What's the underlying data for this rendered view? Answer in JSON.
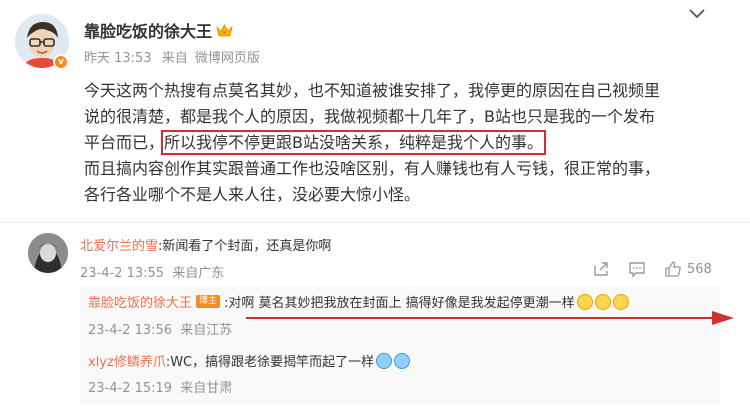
{
  "post": {
    "author": "靠脸吃饭的徐大王",
    "time": "昨天 13:53",
    "source_prefix": "来自",
    "source": "微博网页版",
    "line1": "今天这两个热搜有点莫名其妙，也不知道被谁安排了，我停更的原因在自己视频里",
    "line2": "说的很清楚，都是我个人的原因，我做视频都十几年了，B站也只是我的一个发布",
    "line3_pre": "平台而已，",
    "line3_highlight": "所以我停不停更跟B站没啥关系，纯粹是我个人的事。",
    "line4": "而且搞内容创作其实跟普通工作也没啥区别，有人赚钱也有人亏钱，很正常的事，",
    "line5": "各行各业哪个不是人来人往，没必要大惊小怪。"
  },
  "comment": {
    "username": "北爱尔兰的雪",
    "text": ":新闻看了个封面，还真是你啊",
    "time": "23-4-2 13:55",
    "location": "来自广东",
    "likes": "568"
  },
  "replies": [
    {
      "username": "靠脸吃饭的徐大王",
      "tag": "博主",
      "text": ":对啊 莫名其妙把我放在封面上 搞得好像是我发起停更潮一样",
      "time": "23-4-2 13:56",
      "location": "来自江苏"
    },
    {
      "username": "xlyz修鳞养爪",
      "text": ":WC，搞得跟老徐要揭竿而起了一样",
      "time": "23-4-2 15:19",
      "location": "来自甘肃"
    }
  ],
  "colors": {
    "username": "#eb7350",
    "highlight_box": "#d32f2f",
    "meta": "#939393",
    "verified_badge": "#f78b1f"
  },
  "icons": [
    "chevron-down-icon",
    "crown-icon",
    "verified-badge-icon",
    "share-icon",
    "comment-icon",
    "like-icon",
    "emoji-icon"
  ]
}
